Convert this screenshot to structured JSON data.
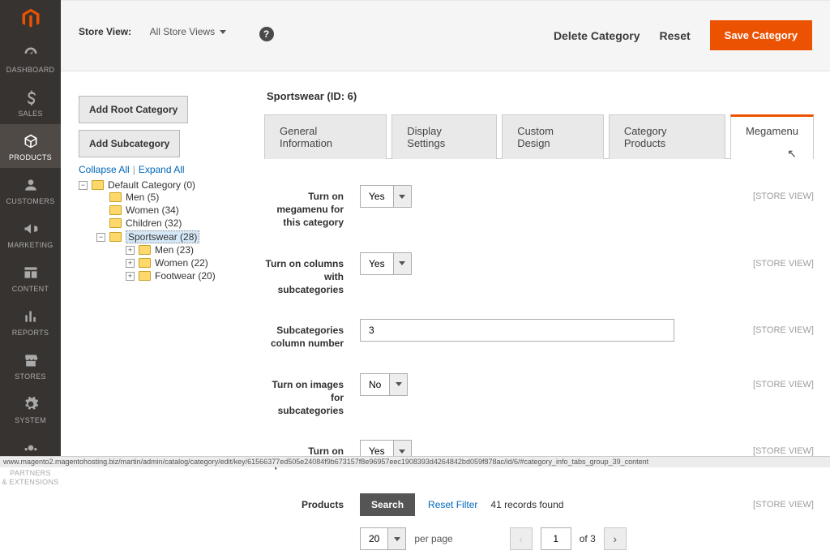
{
  "nav": {
    "items": [
      {
        "label": "DASHBOARD"
      },
      {
        "label": "SALES"
      },
      {
        "label": "PRODUCTS"
      },
      {
        "label": "CUSTOMERS"
      },
      {
        "label": "MARKETING"
      },
      {
        "label": "CONTENT"
      },
      {
        "label": "REPORTS"
      },
      {
        "label": "STORES"
      },
      {
        "label": "SYSTEM"
      },
      {
        "label": "FIND PARTNERS\n& EXTENSIONS"
      }
    ]
  },
  "topbar": {
    "store_view_label": "Store View:",
    "store_view_value": "All Store Views",
    "delete": "Delete Category",
    "reset": "Reset",
    "save": "Save Category"
  },
  "catpanel": {
    "add_root": "Add Root Category",
    "add_sub": "Add Subcategory",
    "collapse": "Collapse All",
    "expand": "Expand All"
  },
  "tree": {
    "root": "Default Category (0)",
    "men": "Men (5)",
    "women": "Women (34)",
    "children": "Children (32)",
    "sportswear": "Sportswear (28)",
    "sw_men": "Men (23)",
    "sw_women": "Women (22)",
    "sw_footwear": "Footwear (20)"
  },
  "main": {
    "title": "Sportswear (ID: 6)",
    "tabs": [
      {
        "label": "General Information"
      },
      {
        "label": "Display Settings"
      },
      {
        "label": "Custom Design"
      },
      {
        "label": "Category Products"
      },
      {
        "label": "Megamenu"
      }
    ],
    "scope": "[STORE VIEW]",
    "fields": {
      "megamenu_label": "Turn on megamenu for this category",
      "megamenu_value": "Yes",
      "columns_label": "Turn on columns with subcategories",
      "columns_value": "Yes",
      "colnum_label": "Subcategories column number",
      "colnum_value": "3",
      "images_label": "Turn on images for subcategories",
      "images_value": "No",
      "prodshow_label": "Turn on products show",
      "prodshow_value": "Yes",
      "products_label": "Products"
    },
    "products": {
      "search": "Search",
      "reset_filter": "Reset Filter",
      "records": "41 records found",
      "per_page_value": "20",
      "per_page_label": "per page",
      "page": "1",
      "of": "of 3"
    }
  },
  "statusbar": "www.magento2.magentohosting.biz/martin/admin/catalog/category/edit/key/61566377ed505e24084f9b673157f8e96957eec1908393d4264842bd059f878ac/id/6/#category_info_tabs_group_39_content"
}
